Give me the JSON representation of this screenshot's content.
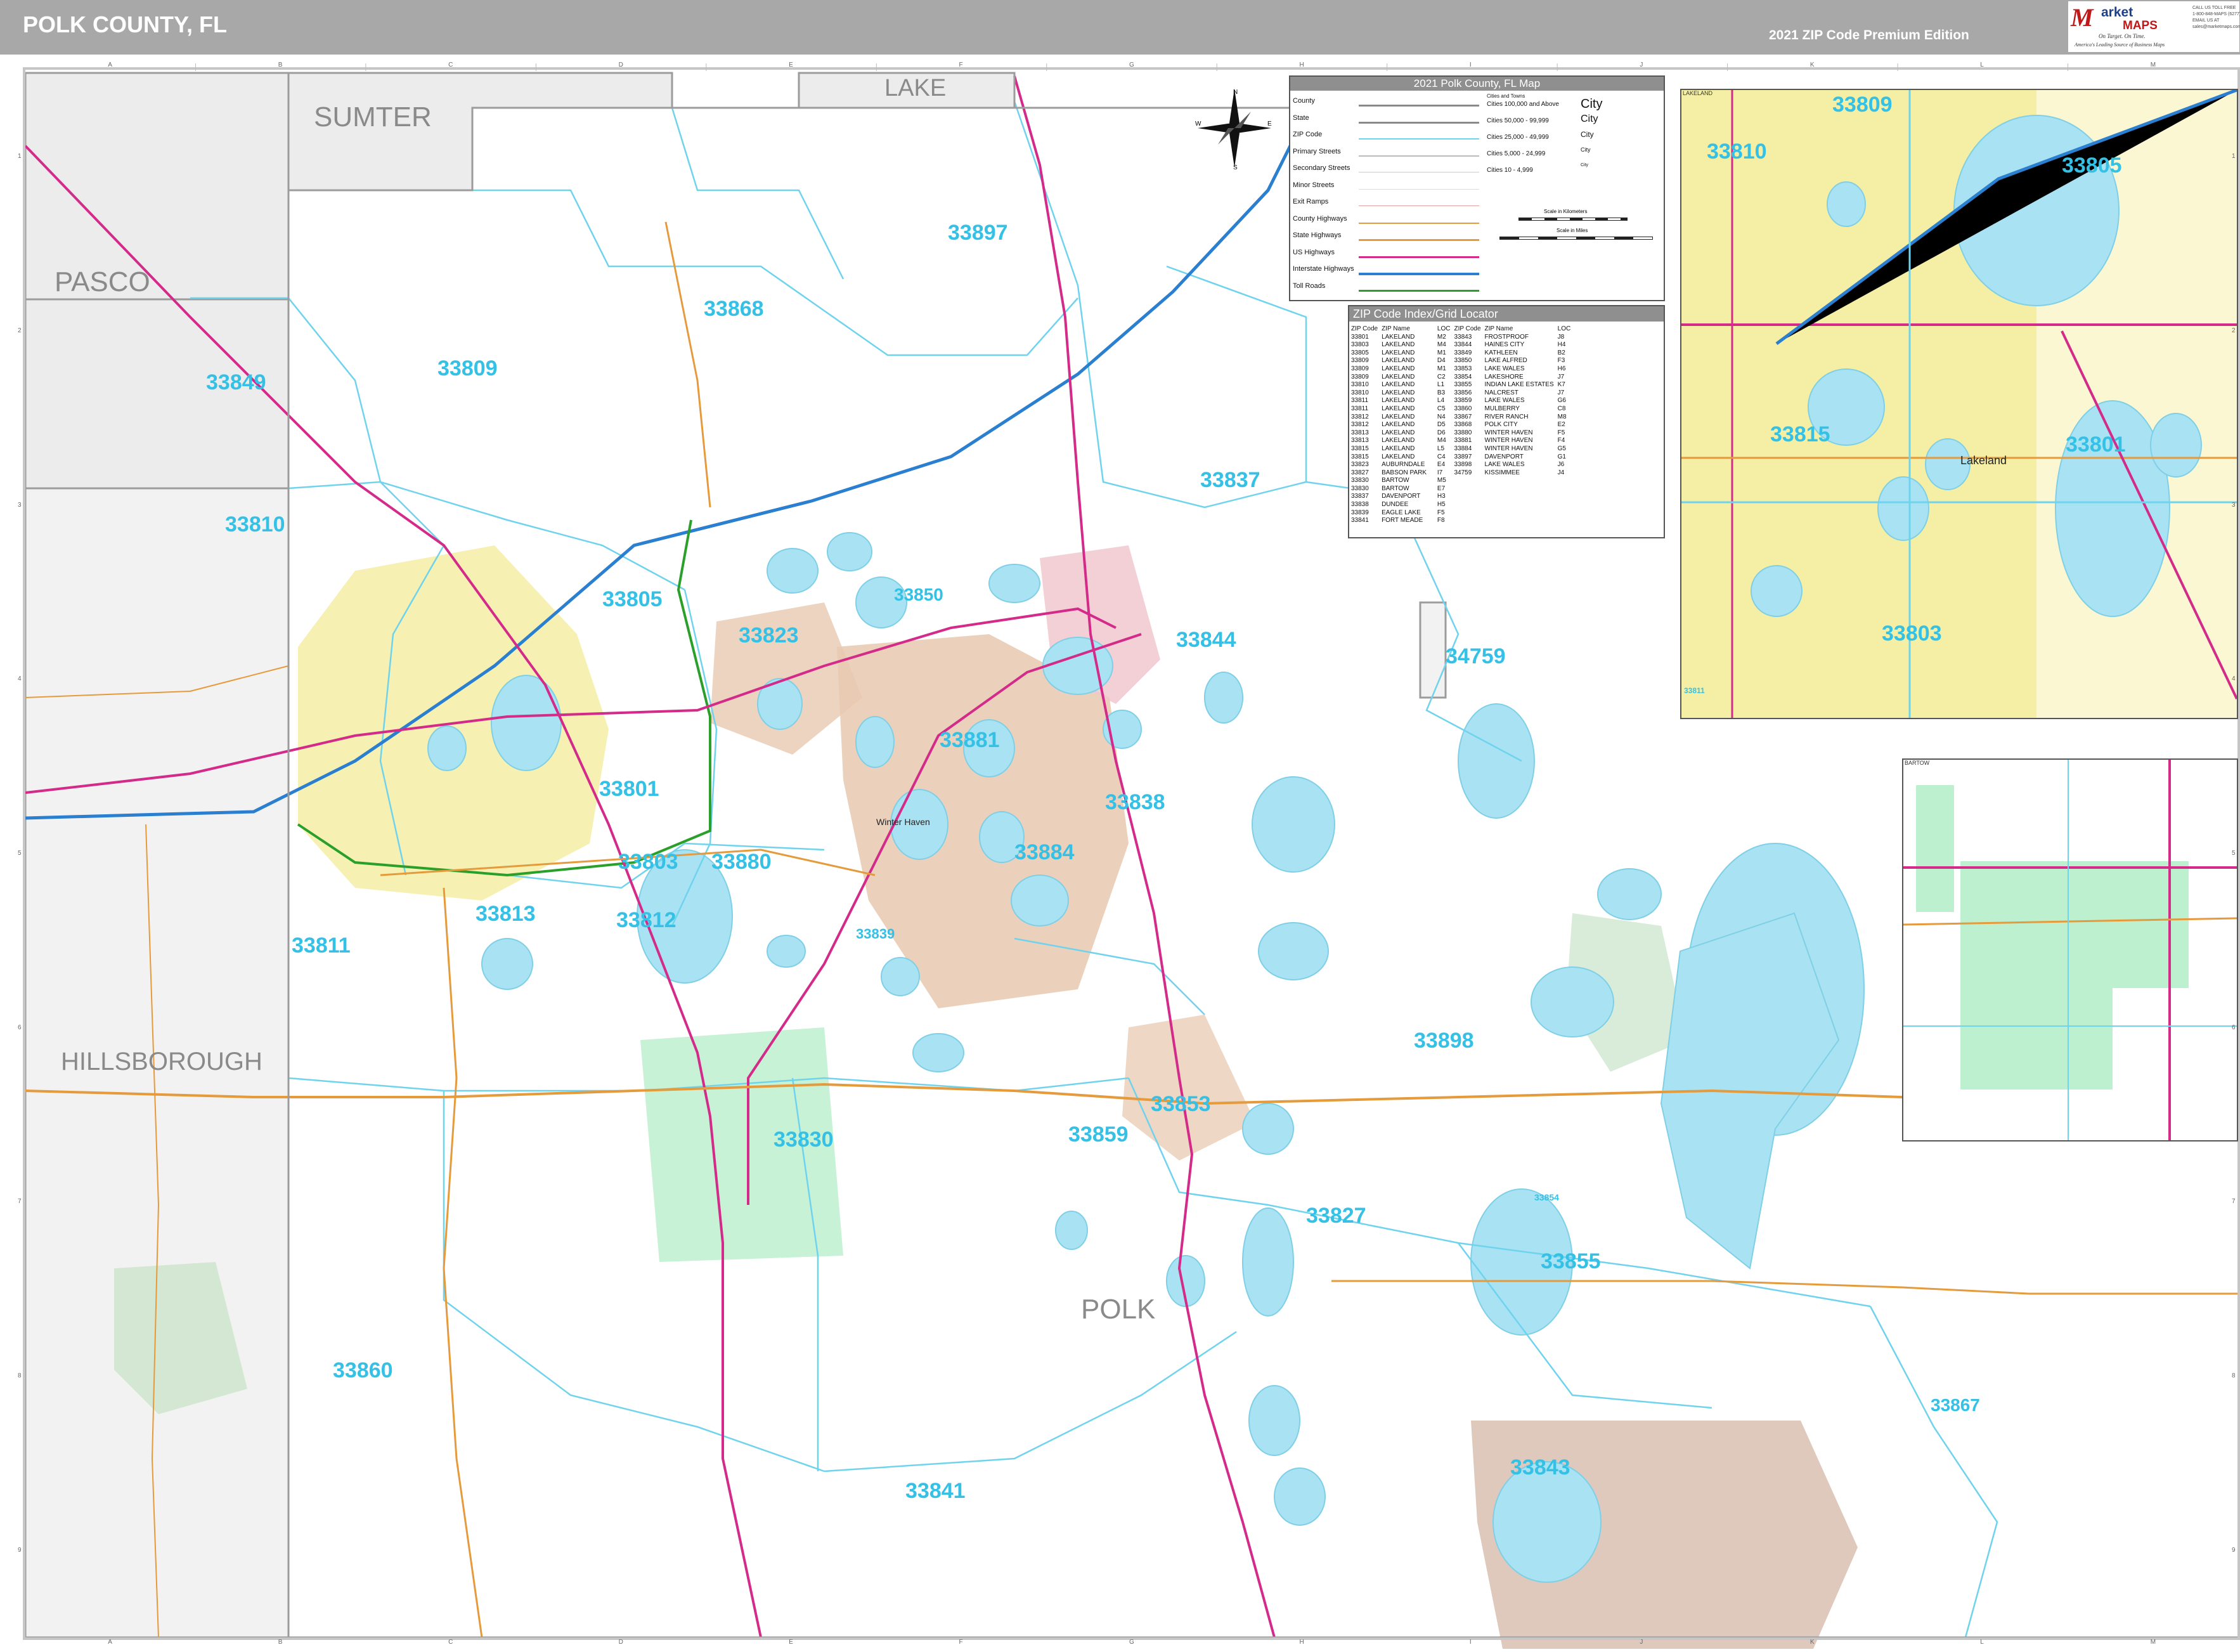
{
  "header": {
    "title": "POLK COUNTY, FL",
    "edition": "2021 ZIP Code Premium Edition",
    "brand": {
      "logo_letter": "M",
      "logo_word": "arket",
      "logo_word2": "MAPS",
      "tagline": "On Target. On Time.",
      "slogan": "America's Leading Source of Business Maps",
      "contact": [
        "CALL US TOLL FREE",
        "1-800-848-MAPS (6277)",
        "EMAIL US AT",
        "sales@marketmaps.com"
      ]
    }
  },
  "colors": {
    "water": "#a9e3f3",
    "zip_label": "#35c0e6",
    "zip_boundary": "#6fd3ee",
    "county_outside": "#ececec",
    "interstate": "#2a7fd0",
    "us_highway": "#d42a8a",
    "state_highway": "#e59a3c",
    "toll_road": "#2aa02a",
    "city_lakeland": "#f4efa4",
    "city_winter_haven": "#e8c9b0",
    "city_haines": "#f1c7cf",
    "city_bartow": "#bdf0cf",
    "indian_lake_estates": "#d9bfb0",
    "park": "#cfe6cf"
  },
  "map": {
    "grid": {
      "columns": [
        "A",
        "B",
        "C",
        "D",
        "E",
        "F",
        "G",
        "H",
        "I",
        "J",
        "K",
        "L",
        "M"
      ],
      "rows": [
        "1",
        "2",
        "3",
        "4",
        "5",
        "6",
        "7",
        "8",
        "9"
      ]
    },
    "counties": [
      {
        "name": "SUMTER"
      },
      {
        "name": "LAKE"
      },
      {
        "name": "PASCO"
      },
      {
        "name": "HILLSBOROUGH"
      },
      {
        "name": "POLK"
      }
    ],
    "zip_labels": [
      "33897",
      "33868",
      "33849",
      "33809",
      "33810",
      "33837",
      "33805",
      "33850",
      "33823",
      "33844",
      "34759",
      "33881",
      "33801",
      "33838",
      "33803",
      "33880",
      "33884",
      "33813",
      "33812",
      "33811",
      "33839",
      "33898",
      "33830",
      "33853",
      "33859",
      "33827",
      "33854",
      "33855",
      "33860",
      "33867",
      "33843",
      "33841",
      "33815"
    ],
    "places": [
      "Winter Haven",
      "Lakeland"
    ]
  },
  "legend": {
    "title": "2021 Polk County, FL Map",
    "line_items": [
      "County",
      "State",
      "ZIP Code",
      "Primary Streets",
      "Secondary Streets",
      "Minor Streets",
      "Exit Ramps",
      "County Highways",
      "State Highways",
      "US Highways",
      "Interstate Highways",
      "Toll Roads"
    ],
    "cities_heading": "Cities and Towns",
    "cities": [
      {
        "label": "Cities 100,000 and Above",
        "sample": "City"
      },
      {
        "label": "Cities 50,000 - 99,999",
        "sample": "City"
      },
      {
        "label": "Cities 25,000 - 49,999",
        "sample": "City"
      },
      {
        "label": "Cities 5,000 - 24,999",
        "sample": "City"
      },
      {
        "label": "Cities 10 - 4,999",
        "sample": "City"
      }
    ],
    "scale_km": "Scale in Kilometers",
    "scale_mi": "Scale in Miles"
  },
  "zip_index": {
    "title": "ZIP Code Index/Grid Locator",
    "headers": [
      "ZIP Code",
      "ZIP Name",
      "LOC",
      "ZIP Code",
      "ZIP Name",
      "LOC"
    ],
    "rows": [
      [
        "33801",
        "LAKELAND",
        "M2",
        "33843",
        "FROSTPROOF",
        "J8"
      ],
      [
        "33803",
        "LAKELAND",
        "M4",
        "33844",
        "HAINES CITY",
        "H4"
      ],
      [
        "33805",
        "LAKELAND",
        "M1",
        "33849",
        "KATHLEEN",
        "B2"
      ],
      [
        "33809",
        "LAKELAND",
        "D4",
        "33850",
        "LAKE ALFRED",
        "F3"
      ],
      [
        "33809",
        "LAKELAND",
        "M1",
        "33853",
        "LAKE WALES",
        "H6"
      ],
      [
        "33809",
        "LAKELAND",
        "C2",
        "33854",
        "LAKESHORE",
        "J7"
      ],
      [
        "33810",
        "LAKELAND",
        "L1",
        "33855",
        "INDIAN LAKE ESTATES",
        "K7"
      ],
      [
        "33810",
        "LAKELAND",
        "B3",
        "33856",
        "NALCREST",
        "J7"
      ],
      [
        "33811",
        "LAKELAND",
        "L4",
        "33859",
        "LAKE WALES",
        "G6"
      ],
      [
        "33811",
        "LAKELAND",
        "C5",
        "33860",
        "MULBERRY",
        "C8"
      ],
      [
        "33812",
        "LAKELAND",
        "N4",
        "33867",
        "RIVER RANCH",
        "M8"
      ],
      [
        "33812",
        "LAKELAND",
        "D5",
        "33868",
        "POLK CITY",
        "E2"
      ],
      [
        "33813",
        "LAKELAND",
        "D6",
        "33880",
        "WINTER HAVEN",
        "F5"
      ],
      [
        "33813",
        "LAKELAND",
        "M4",
        "33881",
        "WINTER HAVEN",
        "F4"
      ],
      [
        "33815",
        "LAKELAND",
        "L5",
        "33884",
        "WINTER HAVEN",
        "G5"
      ],
      [
        "33815",
        "LAKELAND",
        "C4",
        "33897",
        "DAVENPORT",
        "G1"
      ],
      [
        "33823",
        "AUBURNDALE",
        "E4",
        "33898",
        "LAKE WALES",
        "J6"
      ],
      [
        "33827",
        "BABSON PARK",
        "I7",
        "34759",
        "KISSIMMEE",
        "J4"
      ],
      [
        "33830",
        "BARTOW",
        "M5",
        "",
        "",
        ""
      ],
      [
        "33830",
        "BARTOW",
        "E7",
        "",
        "",
        ""
      ],
      [
        "33837",
        "DAVENPORT",
        "H3",
        "",
        "",
        ""
      ],
      [
        "33838",
        "DUNDEE",
        "H5",
        "",
        "",
        ""
      ],
      [
        "33839",
        "EAGLE LAKE",
        "F5",
        "",
        "",
        ""
      ],
      [
        "33841",
        "FORT MEADE",
        "F8",
        "",
        "",
        ""
      ]
    ]
  },
  "insets": {
    "lakeland": {
      "tag": "LAKELAND",
      "zips": [
        "33809",
        "33810",
        "33805",
        "33815",
        "33801",
        "33803",
        "33811"
      ],
      "place": "Lakeland"
    },
    "bartow": {
      "tag": "BARTOW"
    }
  }
}
